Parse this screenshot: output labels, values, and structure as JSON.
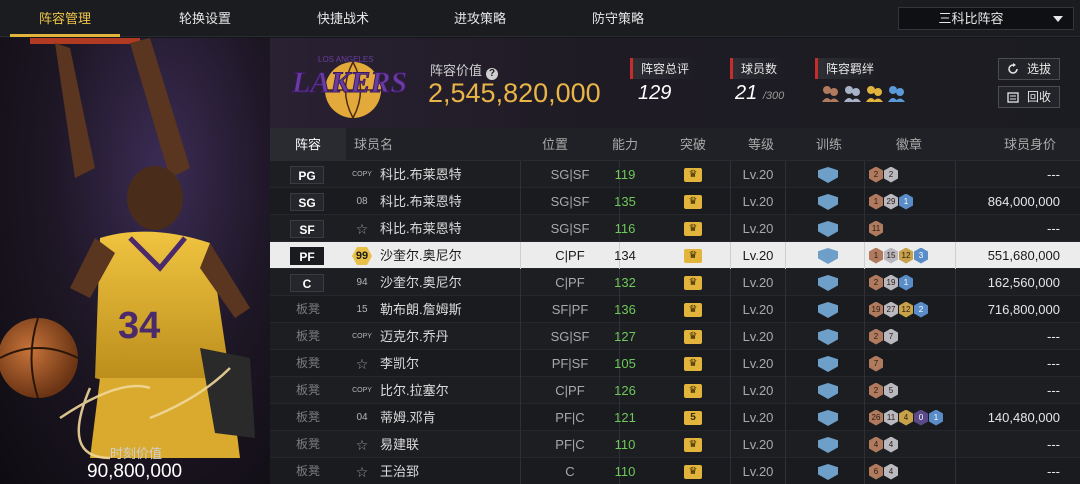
{
  "nav": {
    "tabs": [
      "阵容管理",
      "轮换设置",
      "快捷战术",
      "进攻策略",
      "防守策略"
    ],
    "active_tab": 0,
    "lineup_select": "三科比阵容"
  },
  "portrait": {
    "jersey_number": "34",
    "moment_label": "时刻价值",
    "moment_value": "90,800,000"
  },
  "header": {
    "team_logo_text": "LAKERS",
    "team_logo_subtext": "LOS ANGELES",
    "lineup_value_label": "阵容价值",
    "lineup_value": "2,545,820,000",
    "overall_label": "阵容总评",
    "overall_value": "129",
    "player_count_label": "球员数",
    "player_count_value": "21",
    "player_count_max": "/300",
    "bond_label": "阵容羁绊",
    "btn_select": "选拔",
    "btn_recycle": "回收"
  },
  "table": {
    "headers": {
      "slot": "阵容",
      "name": "球员名",
      "position": "位置",
      "ability": "能力",
      "breakthrough": "突破",
      "level": "等级",
      "training": "训练",
      "badges": "徽章",
      "value": "球员身价"
    },
    "rows": [
      {
        "slot": "PG",
        "starter": true,
        "tag": "COPY",
        "tag_type": "copy",
        "name": "科比.布莱恩特",
        "position": "SG|SF",
        "ability": "119",
        "break": "",
        "level": "Lv.20",
        "badges": [
          {
            "t": "bronze",
            "v": "2"
          },
          {
            "t": "silver",
            "v": "2"
          }
        ],
        "value": "---",
        "selected": false
      },
      {
        "slot": "SG",
        "starter": true,
        "tag": "08",
        "tag_type": "num",
        "name": "科比.布莱恩特",
        "position": "SG|SF",
        "ability": "135",
        "break": "",
        "level": "Lv.20",
        "badges": [
          {
            "t": "bronze",
            "v": "1"
          },
          {
            "t": "silver",
            "v": "29"
          },
          {
            "t": "blue",
            "v": "1"
          }
        ],
        "value": "864,000,000",
        "selected": false
      },
      {
        "slot": "SF",
        "starter": true,
        "tag": "☆",
        "tag_type": "star",
        "name": "科比.布莱恩特",
        "position": "SG|SF",
        "ability": "116",
        "break": "",
        "level": "Lv.20",
        "badges": [
          {
            "t": "bronze",
            "v": "11"
          }
        ],
        "value": "---",
        "selected": false
      },
      {
        "slot": "PF",
        "starter": true,
        "tag": "99",
        "tag_type": "hex",
        "name": "沙奎尔.奥尼尔",
        "position": "C|PF",
        "ability": "134",
        "break": "",
        "level": "Lv.20",
        "badges": [
          {
            "t": "bronze",
            "v": "1"
          },
          {
            "t": "silver",
            "v": "15"
          },
          {
            "t": "gold",
            "v": "12"
          },
          {
            "t": "blue",
            "v": "3"
          }
        ],
        "value": "551,680,000",
        "selected": true
      },
      {
        "slot": "C",
        "starter": true,
        "tag": "94",
        "tag_type": "num",
        "name": "沙奎尔.奥尼尔",
        "position": "C|PF",
        "ability": "132",
        "break": "",
        "level": "Lv.20",
        "badges": [
          {
            "t": "bronze",
            "v": "2"
          },
          {
            "t": "silver",
            "v": "19"
          },
          {
            "t": "blue",
            "v": "1"
          }
        ],
        "value": "162,560,000",
        "selected": false
      },
      {
        "slot": "板凳",
        "starter": false,
        "tag": "15",
        "tag_type": "num",
        "name": "勒布朗.詹姆斯",
        "position": "SF|PF",
        "ability": "136",
        "break": "",
        "level": "Lv.20",
        "badges": [
          {
            "t": "bronze",
            "v": "19"
          },
          {
            "t": "silver",
            "v": "27"
          },
          {
            "t": "gold",
            "v": "12"
          },
          {
            "t": "blue",
            "v": "2"
          }
        ],
        "value": "716,800,000",
        "selected": false
      },
      {
        "slot": "板凳",
        "starter": false,
        "tag": "COPY",
        "tag_type": "copy",
        "name": "迈克尔.乔丹",
        "position": "SG|SF",
        "ability": "127",
        "break": "",
        "level": "Lv.20",
        "badges": [
          {
            "t": "bronze",
            "v": "2"
          },
          {
            "t": "silver",
            "v": "7"
          }
        ],
        "value": "---",
        "selected": false
      },
      {
        "slot": "板凳",
        "starter": false,
        "tag": "☆",
        "tag_type": "star",
        "name": "李凯尔",
        "position": "PF|SF",
        "ability": "105",
        "break": "",
        "level": "Lv.20",
        "badges": [
          {
            "t": "bronze",
            "v": "7"
          }
        ],
        "value": "---",
        "selected": false
      },
      {
        "slot": "板凳",
        "starter": false,
        "tag": "COPY",
        "tag_type": "copy",
        "name": "比尔.拉塞尔",
        "position": "C|PF",
        "ability": "126",
        "break": "",
        "level": "Lv.20",
        "badges": [
          {
            "t": "bronze",
            "v": "2"
          },
          {
            "t": "silver",
            "v": "5"
          }
        ],
        "value": "---",
        "selected": false
      },
      {
        "slot": "板凳",
        "starter": false,
        "tag": "04",
        "tag_type": "num",
        "name": "蒂姆.邓肯",
        "position": "PF|C",
        "ability": "121",
        "break": "5",
        "level": "Lv.20",
        "badges": [
          {
            "t": "bronze",
            "v": "26"
          },
          {
            "t": "silver",
            "v": "11"
          },
          {
            "t": "gold",
            "v": "4"
          },
          {
            "t": "purple",
            "v": "0"
          },
          {
            "t": "blue",
            "v": "1"
          }
        ],
        "value": "140,480,000",
        "selected": false
      },
      {
        "slot": "板凳",
        "starter": false,
        "tag": "☆",
        "tag_type": "star",
        "name": "易建联",
        "position": "PF|C",
        "ability": "110",
        "break": "",
        "level": "Lv.20",
        "badges": [
          {
            "t": "bronze",
            "v": "4"
          },
          {
            "t": "silver",
            "v": "4"
          }
        ],
        "value": "---",
        "selected": false
      },
      {
        "slot": "板凳",
        "starter": false,
        "tag": "☆",
        "tag_type": "star",
        "name": "王治郅",
        "position": "C",
        "ability": "110",
        "break": "",
        "level": "Lv.20",
        "badges": [
          {
            "t": "bronze",
            "v": "6"
          },
          {
            "t": "silver",
            "v": "4"
          }
        ],
        "value": "---",
        "selected": false
      }
    ]
  }
}
